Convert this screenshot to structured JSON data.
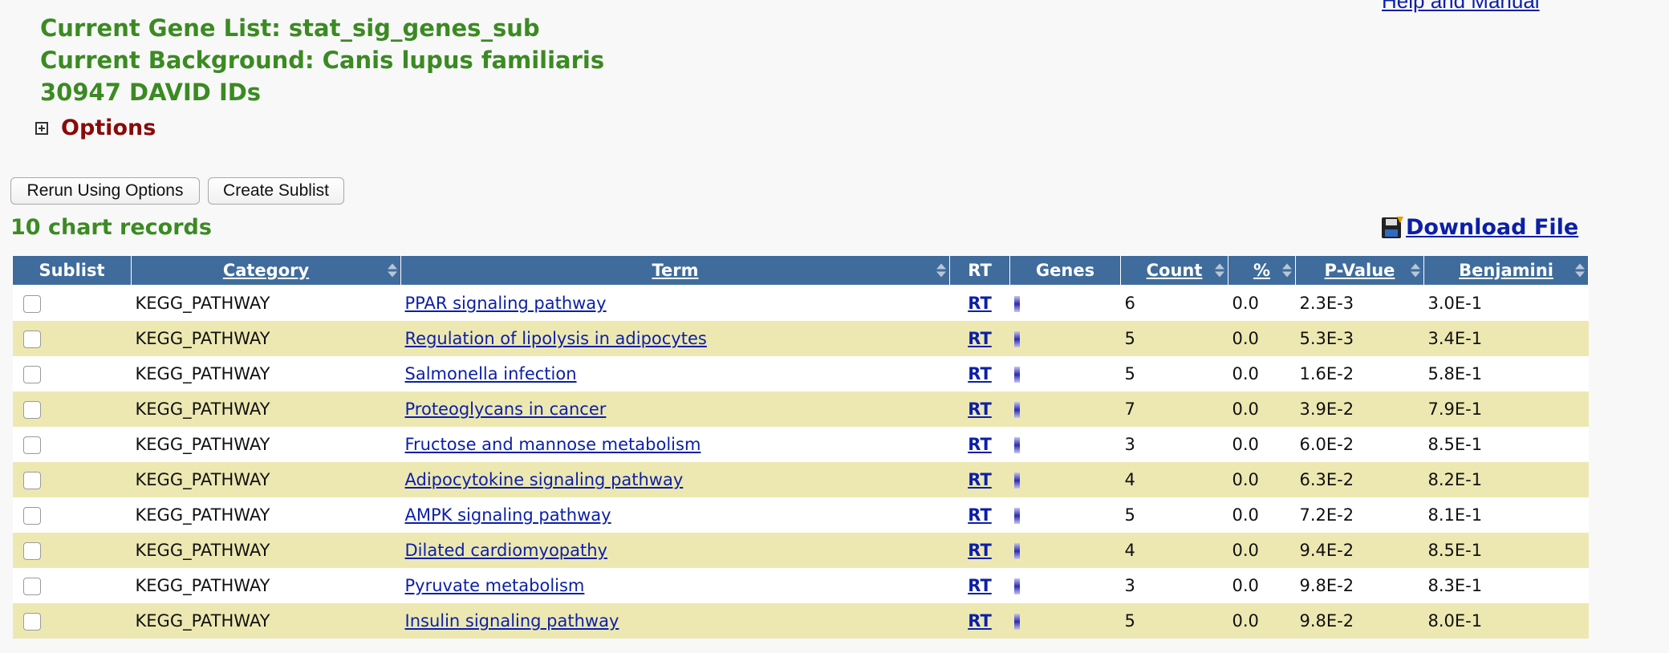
{
  "header": {
    "help_link": "Help and Manual",
    "gene_list_line": "Current Gene List: stat_sig_genes_sub",
    "background_line": "Current Background: Canis lupus familiaris",
    "ids_line": "30947 DAVID IDs",
    "options_label": "Options"
  },
  "buttons": {
    "rerun": "Rerun Using Options",
    "create_sublist": "Create Sublist"
  },
  "records_text": "10 chart records",
  "download_label": "Download File",
  "columns": {
    "sublist": "Sublist",
    "category": "Category",
    "term": "Term",
    "rt": "RT",
    "genes": "Genes",
    "count": "Count",
    "percent": "%",
    "pvalue": "P-Value",
    "benjamini": "Benjamini"
  },
  "rows": [
    {
      "category": "KEGG_PATHWAY",
      "term": "PPAR signaling pathway",
      "rt": "RT",
      "count": "6",
      "percent": "0.0",
      "pvalue": "2.3E-3",
      "benjamini": "3.0E-1"
    },
    {
      "category": "KEGG_PATHWAY",
      "term": "Regulation of lipolysis in adipocytes",
      "rt": "RT",
      "count": "5",
      "percent": "0.0",
      "pvalue": "5.3E-3",
      "benjamini": "3.4E-1"
    },
    {
      "category": "KEGG_PATHWAY",
      "term": "Salmonella infection",
      "rt": "RT",
      "count": "5",
      "percent": "0.0",
      "pvalue": "1.6E-2",
      "benjamini": "5.8E-1"
    },
    {
      "category": "KEGG_PATHWAY",
      "term": "Proteoglycans in cancer",
      "rt": "RT",
      "count": "7",
      "percent": "0.0",
      "pvalue": "3.9E-2",
      "benjamini": "7.9E-1"
    },
    {
      "category": "KEGG_PATHWAY",
      "term": "Fructose and mannose metabolism",
      "rt": "RT",
      "count": "3",
      "percent": "0.0",
      "pvalue": "6.0E-2",
      "benjamini": "8.5E-1"
    },
    {
      "category": "KEGG_PATHWAY",
      "term": "Adipocytokine signaling pathway",
      "rt": "RT",
      "count": "4",
      "percent": "0.0",
      "pvalue": "6.3E-2",
      "benjamini": "8.2E-1"
    },
    {
      "category": "KEGG_PATHWAY",
      "term": "AMPK signaling pathway",
      "rt": "RT",
      "count": "5",
      "percent": "0.0",
      "pvalue": "7.2E-2",
      "benjamini": "8.1E-1"
    },
    {
      "category": "KEGG_PATHWAY",
      "term": "Dilated cardiomyopathy",
      "rt": "RT",
      "count": "4",
      "percent": "0.0",
      "pvalue": "9.4E-2",
      "benjamini": "8.5E-1"
    },
    {
      "category": "KEGG_PATHWAY",
      "term": "Pyruvate metabolism",
      "rt": "RT",
      "count": "3",
      "percent": "0.0",
      "pvalue": "9.8E-2",
      "benjamini": "8.3E-1"
    },
    {
      "category": "KEGG_PATHWAY",
      "term": "Insulin signaling pathway",
      "rt": "RT",
      "count": "5",
      "percent": "0.0",
      "pvalue": "9.8E-2",
      "benjamini": "8.0E-1"
    }
  ],
  "colors": {
    "header_green": "#3b8a22",
    "options_red": "#8a0a0a",
    "link_blue": "#0b1fa8",
    "table_header_bg": "#3f6c9c",
    "row_alt_bg": "#ede8b2"
  },
  "icons": {
    "options_toggle": "plus-box-icon",
    "download": "floppy-disk-icon",
    "genes": "gene-bar-icon",
    "sort": "sort-arrows-icon"
  }
}
